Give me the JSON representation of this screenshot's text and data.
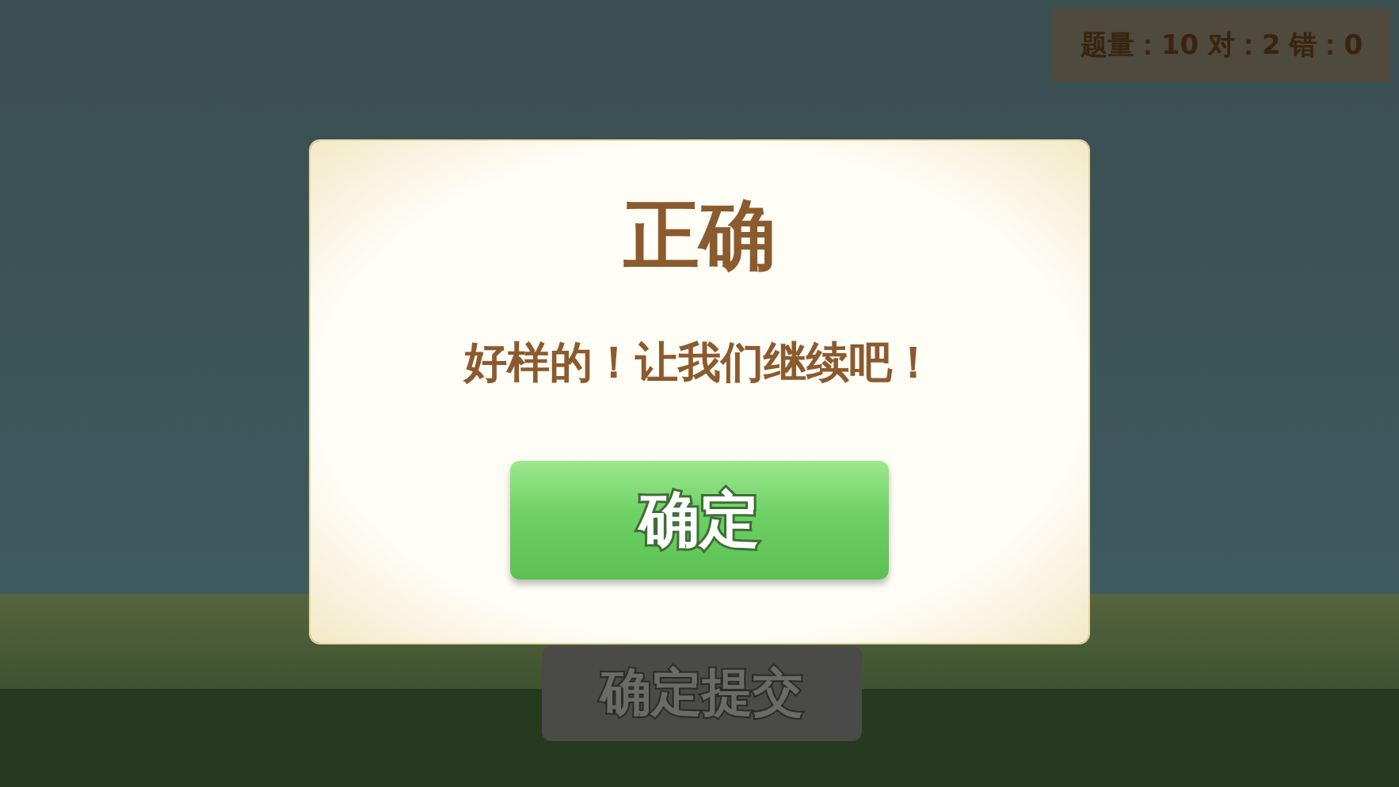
{
  "score_panel": {
    "text": "题量：10 对：2 错：0"
  },
  "submit_button": {
    "label": "确定提交"
  },
  "dialog": {
    "title": "正确",
    "message": "好样的！让我们继续吧！",
    "button": "确定"
  }
}
